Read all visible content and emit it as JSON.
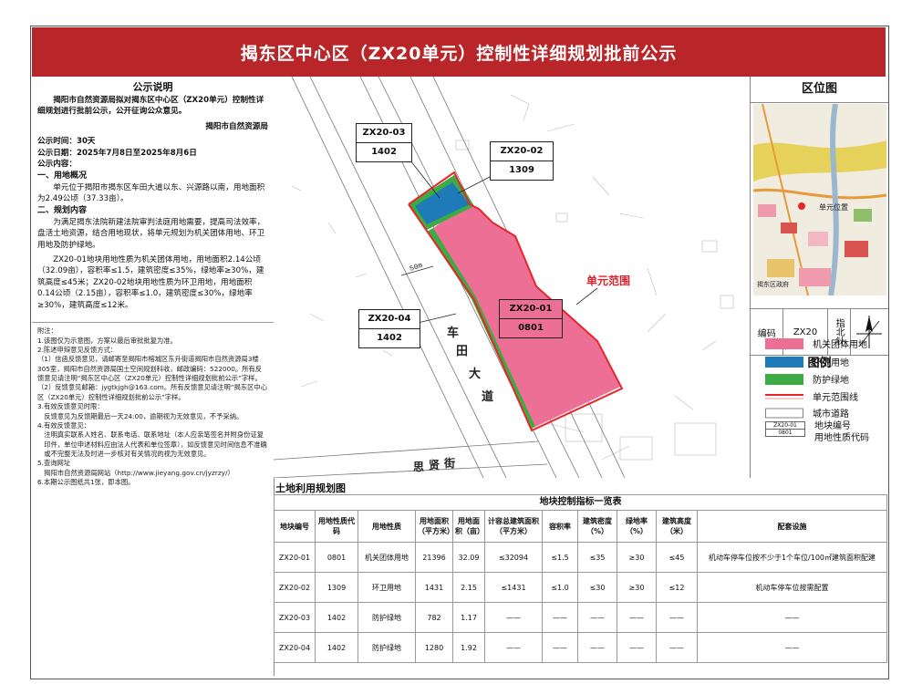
{
  "title": "揭东区中心区（ZX20单元）控制性详细规划批前公示",
  "announcement": {
    "heading": "公示说明",
    "intro": "揭阳市自然资源局拟对揭东区中心区（ZX20单元）控制性详细规划进行批前公示，公开征询公众意见。",
    "issuer": "揭阳市自然资源局",
    "period": "公示时间：30天",
    "dates": "公示日期：2025年7月8日至2025年8月6日",
    "content_label": "公示内容：",
    "sec1_title": "一、用地概况",
    "sec1_text": "单元位于揭阳市揭东区车田大道以东、兴源路以南，用地面积为2.49公顷（37.33亩）。",
    "sec2_title": "二、规划内容",
    "sec2_text1": "为满足揭东法院新建法院审判法庭用地需要，提高司法效率，盘活土地资源，结合用地现状，将单元规划为机关团体用地、环卫用地及防护绿地。",
    "sec2_text2": "ZX20-01地块用地性质为机关团体用地，用地面积2.14公顷（32.09亩），容积率≤1.5，建筑密度≤35%，绿地率≥30%，建筑高度≤45米；ZX20-02地块用地性质为环卫用地，用地面积0.14公顷（2.15亩），容积率≤1.0，建筑密度≤30%，绿地率≥30%，建筑高度≤12米。"
  },
  "notes": [
    "附注：",
    "1.该图仅为示意图，方案以最后审批批复为准。",
    "2.陈述申辩意见反馈方式：",
    "（1）信函反馈意见，请邮寄至揭阳市榕城区东升街道揭阳市自然资源局3楼305室，揭阳市自然资源局国土空间规划科收，邮政编码：522000。所有反馈意见请注明“揭东区中心区（ZX20单元）控制性详细规划批前公示”字样。",
    "（2）反馈意见邮箱：jygtkjgh@163.com。所有反馈意见请注明“揭东区中心区（ZX20单元）控制性详细规划批前公示”字样。",
    "3.有效反馈意见时限：",
    "反馈意见为反馈期最后一天24:00，逾期视为无效意见，不予采纳。",
    "4.有效反馈意见：",
    "注明真实联系人姓名、联系电话、联系地址（本人应亲笔签名并附身份证复印件，单位申述材料应由法人代表和单位签章），如反馈意见时间信息不准确或不完整无法及时进一步核对有关情况的视为无效意见。",
    "5.查询网址",
    "揭阳市自然资源局网站（http://www.jieyang.gov.cn/jyzrzy/）",
    "6.本期公示图纸共1张，即本图。"
  ],
  "map": {
    "title": "土地利用规划图",
    "road_main": "车 田 大 道",
    "road_main_chars": [
      "车",
      "田",
      "大",
      "道"
    ],
    "road_side": "思 贤 街",
    "road_side_chars": [
      "思",
      "贤",
      "街"
    ],
    "boundary_label": "单元范围",
    "scale_label": "50m",
    "parcels": [
      {
        "id": "ZX20-01",
        "code": "0801"
      },
      {
        "id": "ZX20-02",
        "code": "1309"
      },
      {
        "id": "ZX20-03",
        "code": "1402"
      },
      {
        "id": "ZX20-04",
        "code": "1402"
      }
    ]
  },
  "location": {
    "heading": "区位图",
    "site_label": "单元位置",
    "gov_label": "揭东区政府",
    "code_label": "编码",
    "code_value": "ZX20",
    "north_label": "指北针"
  },
  "legend": {
    "heading": "图例",
    "items": [
      {
        "label": "机关团体用地",
        "color": "#ee6f95"
      },
      {
        "label": "环卫用地",
        "color": "#1f7ab8"
      },
      {
        "label": "防护绿地",
        "color": "#3daa45"
      },
      {
        "label": "单元范围线"
      },
      {
        "label": "城市道路"
      },
      {
        "label": "地块编号"
      },
      {
        "label": "用地性质代码"
      }
    ],
    "sample_id": "ZX20-01",
    "sample_code": "0801"
  },
  "table": {
    "caption": "地块控制指标一览表",
    "headers": [
      "地块编号",
      "用地性质代码",
      "用地性质",
      "用地面积（平方米）",
      "用地面积（亩）",
      "计容总建筑面积（平方米）",
      "容积率",
      "建筑密度（%）",
      "绿地率（%）",
      "建筑高度（米）",
      "配套设施"
    ],
    "rows": [
      [
        "ZX20-01",
        "0801",
        "机关团体用地",
        "21396",
        "32.09",
        "≤32094",
        "≤1.5",
        "≤35",
        "≥30",
        "≤45",
        "机动车停车位按不少于1个车位/100㎡建筑面积配建"
      ],
      [
        "ZX20-02",
        "1309",
        "环卫用地",
        "1431",
        "2.15",
        "≤1431",
        "≤1.0",
        "≤30",
        "≥30",
        "≤12",
        "机动车停车位按需配置"
      ],
      [
        "ZX20-03",
        "1402",
        "防护绿地",
        "782",
        "1.17",
        "——",
        "——",
        "——",
        "——",
        "——",
        "——"
      ],
      [
        "ZX20-04",
        "1402",
        "防护绿地",
        "1280",
        "1.92",
        "——",
        "——",
        "——",
        "——",
        "——",
        "——"
      ]
    ]
  },
  "colors": {
    "title_bg": "#b8262a",
    "institution": "#ee6f95",
    "sanitation": "#1f7ab8",
    "green": "#3daa45",
    "boundary": "#e8262a"
  }
}
